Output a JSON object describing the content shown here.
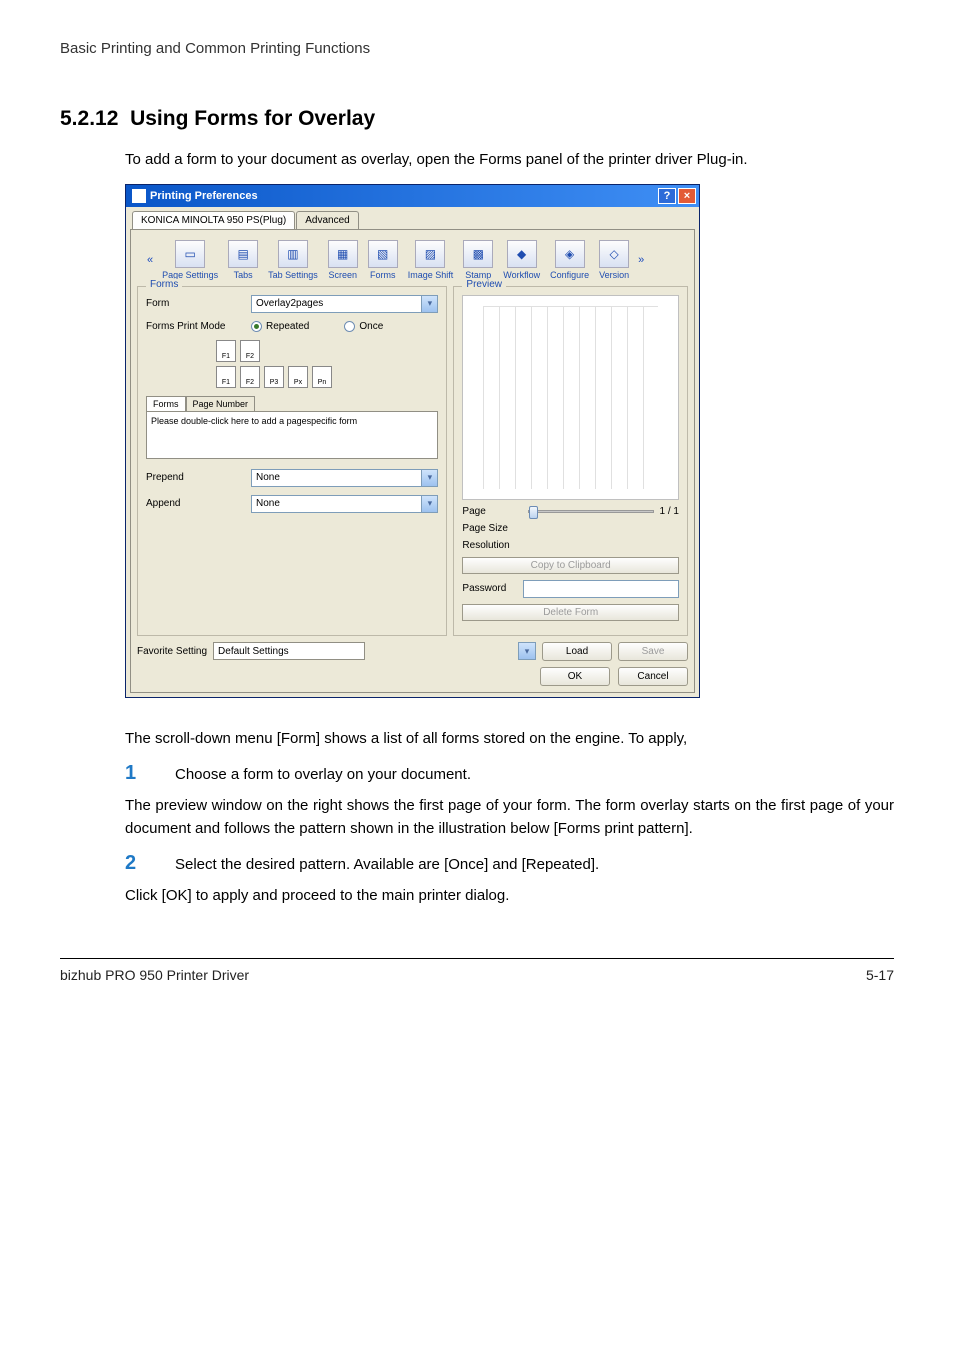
{
  "page": {
    "header": "Basic Printing and Common Printing Functions",
    "section_number": "5.2.12",
    "section_title": "Using Forms for Overlay",
    "intro": "To add a form to your document as overlay, open the Forms panel of the printer driver Plug-in.",
    "para_after_shot": "The scroll-down menu [Form] shows a list of all forms stored on the engine. To apply,",
    "step1_num": "1",
    "step1_text": "Choose a form to overlay on your document.",
    "para_preview": "The preview window on the right shows the first page of your form. The form overlay starts on the first page of your document and follows the pattern shown in the illustration below [Forms print pattern].",
    "step2_num": "2",
    "step2_text": "Select the desired pattern. Available are [Once] and [Repeated].",
    "para_ok": "Click [OK] to apply and proceed to the main printer dialog.",
    "footer_left": "bizhub PRO 950 Printer Driver",
    "footer_right": "5-17"
  },
  "dialog": {
    "title": "Printing Preferences",
    "tabs": {
      "plug": "KONICA MINOLTA 950 PS(Plug)",
      "advanced": "Advanced"
    },
    "toolbar": {
      "left_arrow": "«",
      "right_arrow": "»",
      "items": [
        "Page Settings",
        "Tabs",
        "Tab Settings",
        "Screen",
        "Forms",
        "Image Shift",
        "Stamp",
        "Workflow",
        "Configure",
        "Version"
      ]
    },
    "forms": {
      "legend": "Forms",
      "form_label": "Form",
      "form_value": "Overlay2pages",
      "mode_label": "Forms Print Mode",
      "mode_repeated": "Repeated",
      "mode_once": "Once",
      "pattern_f1": "F1",
      "pattern_f2": "F2",
      "pattern_p3": "P3",
      "pattern_px": "Px",
      "pattern_pn": "Pn",
      "inner_tab_forms": "Forms",
      "inner_tab_page": "Page Number",
      "list_placeholder": "Please double-click here to add a pagespecific form",
      "prepend_label": "Prepend",
      "prepend_value": "None",
      "append_label": "Append",
      "append_value": "None"
    },
    "preview": {
      "legend": "Preview",
      "page_label": "Page",
      "page_value": "1 / 1",
      "pagesize_label": "Page Size",
      "resolution_label": "Resolution",
      "copy_btn": "Copy to Clipboard",
      "password_label": "Password",
      "delete_btn": "Delete Form"
    },
    "favorite": {
      "label": "Favorite Setting",
      "value": "Default Settings",
      "load": "Load",
      "save": "Save"
    },
    "buttons": {
      "ok": "OK",
      "cancel": "Cancel"
    }
  }
}
